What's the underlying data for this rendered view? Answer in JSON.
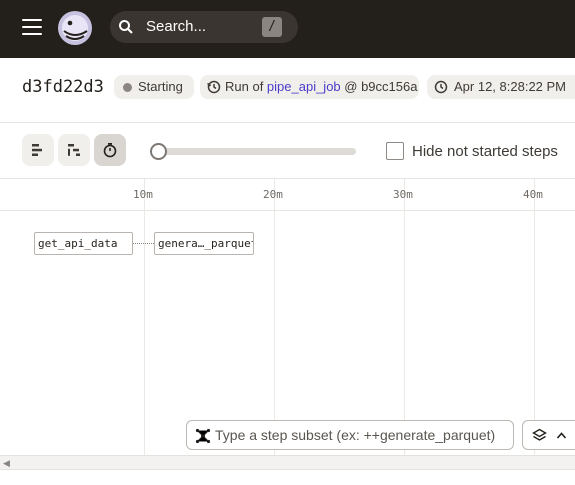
{
  "topbar": {
    "menu_icon": "hamburger-icon",
    "logo_icon": "dagster-logo-icon",
    "search": {
      "placeholder": "Search...",
      "shortcut": "/"
    }
  },
  "run": {
    "id": "d3fd22d3",
    "status": "Starting",
    "status_color": "#8b8683",
    "job_prefix": "Run of ",
    "job_name": "pipe_api_job",
    "job_suffix": " @ b9cc156a",
    "timestamp": "Apr 12, 8:28:22 PM"
  },
  "toolbar": {
    "view_buttons": [
      "flat-view-icon",
      "waterfall-view-icon",
      "timer-icon"
    ],
    "active_view": "timer-icon",
    "hide_label": "Hide not started steps",
    "hide_checked": false
  },
  "timeline": {
    "ticks": [
      "10m",
      "20m",
      "30m",
      "40m"
    ],
    "steps": [
      {
        "label": "get_api_data"
      },
      {
        "label": "genera…_parquet"
      }
    ]
  },
  "subset": {
    "placeholder": "Type a step subset (ex: ++generate_parquet)"
  },
  "colors": {
    "topbar": "#231f1b",
    "job_link": "#4a3dc9"
  }
}
